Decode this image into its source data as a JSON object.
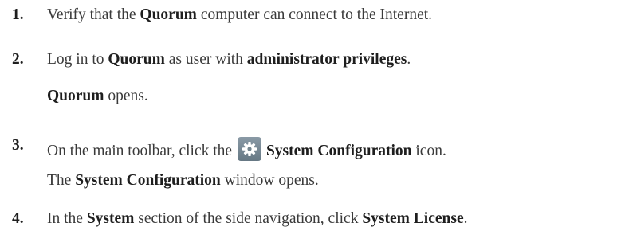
{
  "steps": [
    {
      "number": "1.",
      "parts": [
        "Verify that the ",
        "Quorum",
        " computer can connect to the Internet."
      ]
    },
    {
      "number": "2.",
      "parts": [
        "Log in to ",
        "Quorum",
        " as user with ",
        "administrator privileges",
        "."
      ],
      "result": [
        "Quorum",
        " opens."
      ]
    },
    {
      "number": "3.",
      "parts": [
        "On the main toolbar, click the ",
        "System Configuration",
        " icon."
      ],
      "icon": "gear-icon",
      "result": [
        "The ",
        "System Configuration",
        " window opens."
      ]
    },
    {
      "number": "4.",
      "parts": [
        "In the ",
        "System",
        " section of the side navigation, click ",
        "System License",
        "."
      ]
    }
  ],
  "colors": {
    "text": "#3a3a3a",
    "bold_text": "#1e1e1e",
    "icon_bg": "#7a8b97"
  }
}
